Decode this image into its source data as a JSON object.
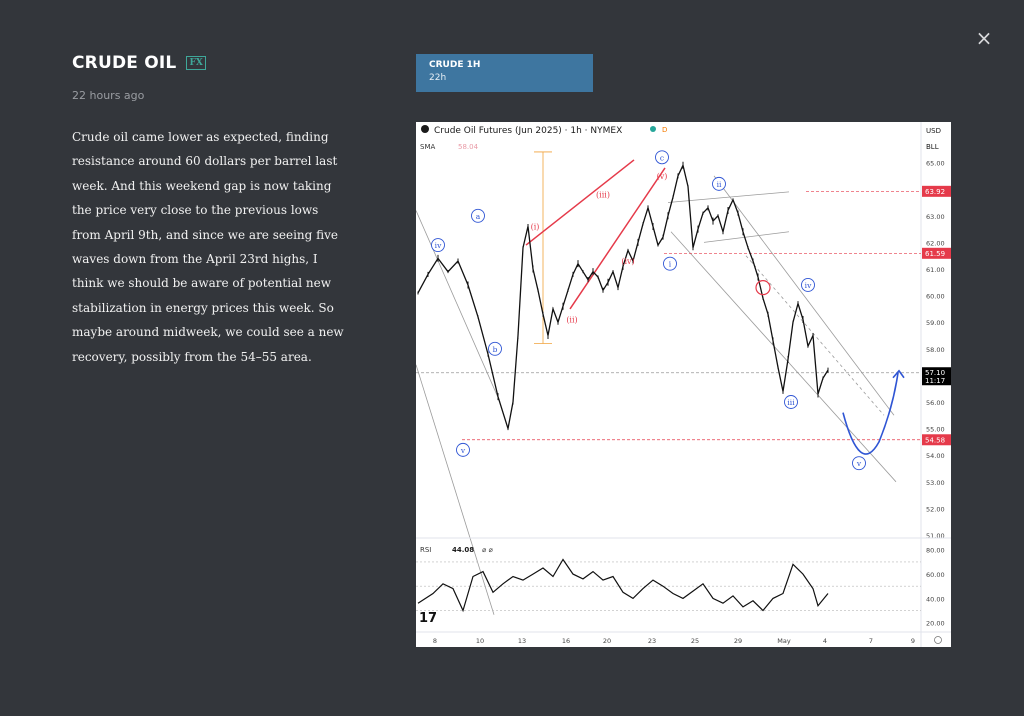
{
  "header": {
    "title": "CRUDE OIL",
    "badge": "FX",
    "time_ago": "22 hours ago"
  },
  "close_icon": "×",
  "description": "Crude oil came lower as expected, finding resistance around 60 dollars per barrel last week. And this weekend gap is now taking the price very close to the previous lows from April 9th, and since we are seeing five waves down from the April 23rd highs, I think we should be aware of potential new stabilization in energy prices this week. So maybe around midweek, we could see a new recovery, possibly from the 54–55 area.",
  "tab": {
    "label": "CRUDE 1H",
    "sub": "22h"
  },
  "chart_data": {
    "type": "line",
    "title": "Crude Oil Futures (Jun 2025) · 1h · NYMEX",
    "currency": "USD",
    "badge": "BLL",
    "sma_label": "SMA",
    "sma_value": "58.04",
    "rsi_label": "RSI",
    "rsi_value": "44.08",
    "rsi_symbols": "⌀ ⌀",
    "x_ticks": [
      "8",
      "10",
      "13",
      "16",
      "20",
      "23",
      "25",
      "29",
      "May",
      "4",
      "7",
      "9"
    ],
    "y_ticks": [
      "65.00",
      "64.00",
      "63.00",
      "62.00",
      "61.00",
      "60.00",
      "59.00",
      "58.00",
      "57.00",
      "56.00",
      "55.00",
      "54.00",
      "53.00",
      "52.00",
      "51.00"
    ],
    "ylim": [
      51,
      66
    ],
    "rsi_ticks": [
      "80.00",
      "60.00",
      "40.00",
      "20.00"
    ],
    "price_tags": [
      {
        "value": "63.92",
        "color": "#e53a4a"
      },
      {
        "value": "61.59",
        "color": "#e53a4a"
      },
      {
        "value": "57.10",
        "sub": "11:17",
        "color": "#000000"
      },
      {
        "value": "54.58",
        "color": "#e53a4a"
      }
    ],
    "price_series": [
      [
        0,
        60.1
      ],
      [
        2,
        60.8
      ],
      [
        4,
        61.4
      ],
      [
        6,
        60.9
      ],
      [
        8,
        61.3
      ],
      [
        10,
        60.4
      ],
      [
        12,
        59.2
      ],
      [
        14,
        57.8
      ],
      [
        16,
        56.2
      ],
      [
        18,
        55.0
      ],
      [
        19,
        56.0
      ],
      [
        20,
        58.5
      ],
      [
        21,
        61.8
      ],
      [
        22,
        62.6
      ],
      [
        23,
        61.0
      ],
      [
        24,
        60.2
      ],
      [
        25,
        59.3
      ],
      [
        26,
        58.5
      ],
      [
        27,
        59.5
      ],
      [
        28,
        59.0
      ],
      [
        29,
        59.6
      ],
      [
        30,
        60.2
      ],
      [
        31,
        60.8
      ],
      [
        32,
        61.2
      ],
      [
        33,
        60.9
      ],
      [
        34,
        60.6
      ],
      [
        35,
        60.9
      ],
      [
        36,
        60.7
      ],
      [
        37,
        60.2
      ],
      [
        38,
        60.5
      ],
      [
        39,
        60.9
      ],
      [
        40,
        60.3
      ],
      [
        41,
        61.1
      ],
      [
        42,
        61.7
      ],
      [
        43,
        61.3
      ],
      [
        44,
        62.0
      ],
      [
        45,
        62.7
      ],
      [
        46,
        63.3
      ],
      [
        47,
        62.6
      ],
      [
        48,
        61.9
      ],
      [
        49,
        62.2
      ],
      [
        50,
        63.0
      ],
      [
        51,
        63.7
      ],
      [
        52,
        64.5
      ],
      [
        53,
        64.9
      ],
      [
        54,
        64.1
      ],
      [
        55,
        61.8
      ],
      [
        56,
        62.5
      ],
      [
        57,
        63.1
      ],
      [
        58,
        63.3
      ],
      [
        59,
        62.8
      ],
      [
        60,
        63.0
      ],
      [
        61,
        62.4
      ],
      [
        62,
        63.2
      ],
      [
        63,
        63.6
      ],
      [
        64,
        63.1
      ],
      [
        65,
        62.4
      ],
      [
        66,
        61.8
      ],
      [
        67,
        61.3
      ],
      [
        68,
        60.7
      ],
      [
        69,
        59.9
      ],
      [
        70,
        59.3
      ],
      [
        71,
        58.3
      ],
      [
        72,
        57.3
      ],
      [
        73,
        56.4
      ],
      [
        74,
        57.6
      ],
      [
        75,
        59.0
      ],
      [
        76,
        59.7
      ],
      [
        77,
        59.1
      ],
      [
        78,
        58.1
      ],
      [
        79,
        58.5
      ],
      [
        80,
        56.3
      ],
      [
        81,
        56.9
      ],
      [
        82,
        57.2
      ]
    ],
    "rsi_series": [
      [
        0,
        36
      ],
      [
        3,
        44
      ],
      [
        5,
        52
      ],
      [
        7,
        48
      ],
      [
        9,
        30
      ],
      [
        11,
        58
      ],
      [
        13,
        62
      ],
      [
        15,
        45
      ],
      [
        17,
        52
      ],
      [
        19,
        58
      ],
      [
        21,
        55
      ],
      [
        23,
        60
      ],
      [
        25,
        65
      ],
      [
        27,
        58
      ],
      [
        29,
        72
      ],
      [
        31,
        60
      ],
      [
        33,
        56
      ],
      [
        35,
        62
      ],
      [
        37,
        55
      ],
      [
        39,
        58
      ],
      [
        41,
        45
      ],
      [
        43,
        40
      ],
      [
        45,
        48
      ],
      [
        47,
        55
      ],
      [
        49,
        50
      ],
      [
        51,
        44
      ],
      [
        53,
        40
      ],
      [
        55,
        46
      ],
      [
        57,
        52
      ],
      [
        59,
        40
      ],
      [
        61,
        36
      ],
      [
        63,
        42
      ],
      [
        65,
        33
      ],
      [
        67,
        38
      ],
      [
        69,
        30
      ],
      [
        71,
        40
      ],
      [
        73,
        44
      ],
      [
        75,
        68
      ],
      [
        77,
        60
      ],
      [
        79,
        48
      ],
      [
        80,
        34
      ],
      [
        82,
        44
      ]
    ],
    "wave_labels": [
      {
        "t": "iv",
        "color": "#2f55d4"
      },
      {
        "t": "a",
        "color": "#2f55d4"
      },
      {
        "t": "b",
        "color": "#2f55d4"
      },
      {
        "t": "v",
        "color": "#2f55d4"
      },
      {
        "t": "(i)",
        "color": "#e53a4a"
      },
      {
        "t": "(ii)",
        "color": "#e53a4a"
      },
      {
        "t": "(iii)",
        "color": "#e53a4a"
      },
      {
        "t": "(iv)",
        "color": "#e53a4a"
      },
      {
        "t": "(v)",
        "color": "#e53a4a"
      },
      {
        "t": "c",
        "color": "#2f55d4"
      },
      {
        "t": "i",
        "color": "#2f55d4"
      },
      {
        "t": "ii",
        "color": "#2f55d4"
      },
      {
        "t": "iii",
        "color": "#2f55d4"
      },
      {
        "t": "iv",
        "color": "#2f55d4"
      },
      {
        "t": "v",
        "color": "#2f55d4"
      }
    ],
    "grid": false
  }
}
